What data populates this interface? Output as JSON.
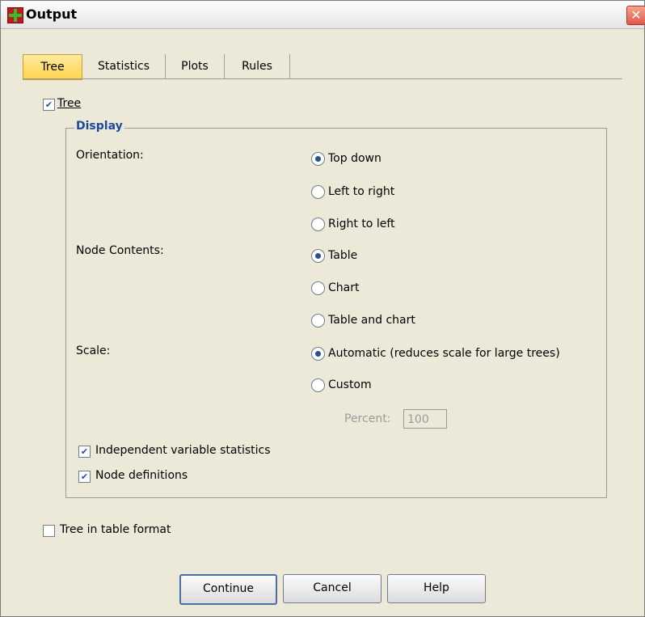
{
  "window": {
    "title": "Output",
    "close_glyph": "✕"
  },
  "tabs": [
    {
      "label": "Tree",
      "active": true
    },
    {
      "label": "Statistics",
      "active": false
    },
    {
      "label": "Plots",
      "active": false
    },
    {
      "label": "Rules",
      "active": false
    }
  ],
  "tree_checkbox": {
    "label": "Tree",
    "checked": true
  },
  "display": {
    "legend": "Display",
    "orientation_label": "Orientation:",
    "orientation_options": [
      "Top down",
      "Left to right",
      "Right to left"
    ],
    "orientation_selected": 0,
    "node_contents_label": "Node Contents:",
    "node_contents_options": [
      "Table",
      "Chart",
      "Table and chart"
    ],
    "node_contents_selected": 0,
    "scale_label": "Scale:",
    "scale_options": [
      "Automatic (reduces scale for large trees)",
      "Custom"
    ],
    "scale_selected": 0,
    "percent_label": "Percent:",
    "percent_value": "100",
    "independent_stats": {
      "label": "Independent variable statistics",
      "checked": true
    },
    "node_definitions": {
      "label": "Node definitions",
      "checked": true
    }
  },
  "table_format": {
    "label": "Tree in table format",
    "checked": false
  },
  "buttons": {
    "continue": "Continue",
    "cancel": "Cancel",
    "help": "Help"
  },
  "colors": {
    "accent": "#1b4a9b",
    "tab_active": "#ffd34d",
    "window_bg": "#ece9d8"
  }
}
